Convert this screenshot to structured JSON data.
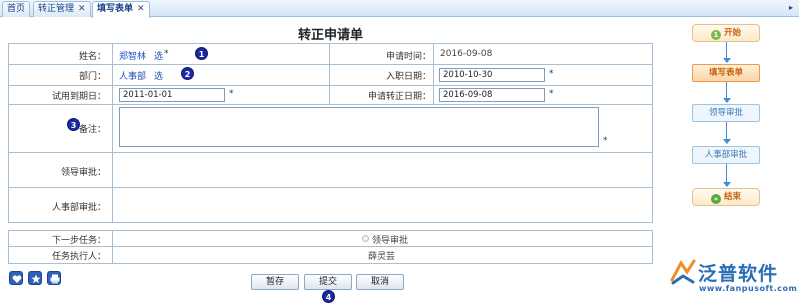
{
  "tabs": [
    {
      "label": "首页",
      "closable": false,
      "active": false
    },
    {
      "label": "转正管理",
      "closable": true,
      "active": false
    },
    {
      "label": "填写表单",
      "closable": true,
      "active": true
    }
  ],
  "tabbar_scroll_icon": "scroll-right-icon",
  "form": {
    "title": "转正申请单",
    "name": {
      "label": "姓名：",
      "value": "郑智林",
      "select_link": "选",
      "required_mark": "*"
    },
    "apply_time": {
      "label": "申请时间：",
      "value": "2016-09-08"
    },
    "department": {
      "label": "部门：",
      "value": "人事部",
      "select_link": "选"
    },
    "entry_date": {
      "label": "入职日期：",
      "value": "2010-10-30",
      "required_mark": "*"
    },
    "probation_end": {
      "label": "试用到期日：",
      "value": "2011-01-01",
      "required_mark": "*"
    },
    "regularize_date": {
      "label": "申请转正日期：",
      "value": "2016-09-08",
      "required_mark": "*"
    },
    "remark": {
      "label": "备注：",
      "value": "",
      "required_mark": "*"
    },
    "leader_approval": {
      "label": "领导审批：",
      "value": ""
    },
    "hr_approval": {
      "label": "人事部审批：",
      "value": ""
    },
    "next_task": {
      "label": "下一步任务：",
      "option": "领导审批"
    },
    "executor": {
      "label": "任务执行人：",
      "value": "薛灵芸"
    }
  },
  "buttons": {
    "save": "暂存",
    "submit": "提交",
    "cancel": "取消"
  },
  "badges": [
    "1",
    "2",
    "3",
    "4"
  ],
  "corner_icons": [
    "heart-icon",
    "star-icon",
    "print-icon"
  ],
  "flow": {
    "start": {
      "label": "开始",
      "icon": "1"
    },
    "nodes": [
      "填写表单",
      "领导审批",
      "人事部审批"
    ],
    "current_index": 0,
    "end": {
      "label": "结束",
      "icon": "»"
    }
  },
  "logo": {
    "name": "泛普软件",
    "url": "www.fanpusoft.com",
    "icon": "fanpu-logo-icon"
  },
  "colors": {
    "link": "#1f4fc2",
    "badge": "#1a2a9c",
    "flow_current": "#f29a49",
    "flow_pending": "#9ec4e4",
    "flow_line": "#3c8ad8",
    "logo": "#2a6fb6"
  }
}
